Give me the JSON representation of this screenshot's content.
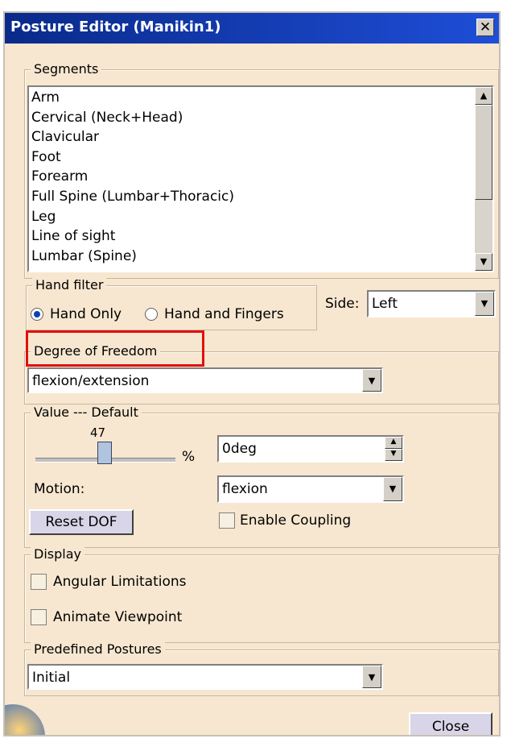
{
  "window": {
    "title": "Posture Editor (Manikin1)"
  },
  "segments": {
    "legend": "Segments",
    "items": [
      "Arm",
      "Cervical (Neck+Head)",
      "Clavicular",
      "Foot",
      "Forearm",
      "Full Spine (Lumbar+Thoracic)",
      "Leg",
      "Line of sight",
      "Lumbar (Spine)"
    ]
  },
  "hand_filter": {
    "legend": "Hand filter",
    "option1": "Hand Only",
    "option2": "Hand and Fingers",
    "selected": "Hand Only"
  },
  "side": {
    "label": "Side:",
    "value": "Left"
  },
  "dof": {
    "legend": "Degree of Freedom",
    "value": "flexion/extension"
  },
  "value_group": {
    "legend": "Value --- Default",
    "slider_value": "47",
    "percent_label": "%",
    "angle_value": "0deg",
    "motion_label": "Motion:",
    "motion_value": "flexion",
    "reset_label": "Reset DOF",
    "coupling_label": "Enable Coupling"
  },
  "display": {
    "legend": "Display",
    "angular_label": "Angular Limitations",
    "animate_label": "Animate Viewpoint"
  },
  "postures": {
    "legend": "Predefined Postures",
    "value": "Initial"
  },
  "close_label": "Close"
}
